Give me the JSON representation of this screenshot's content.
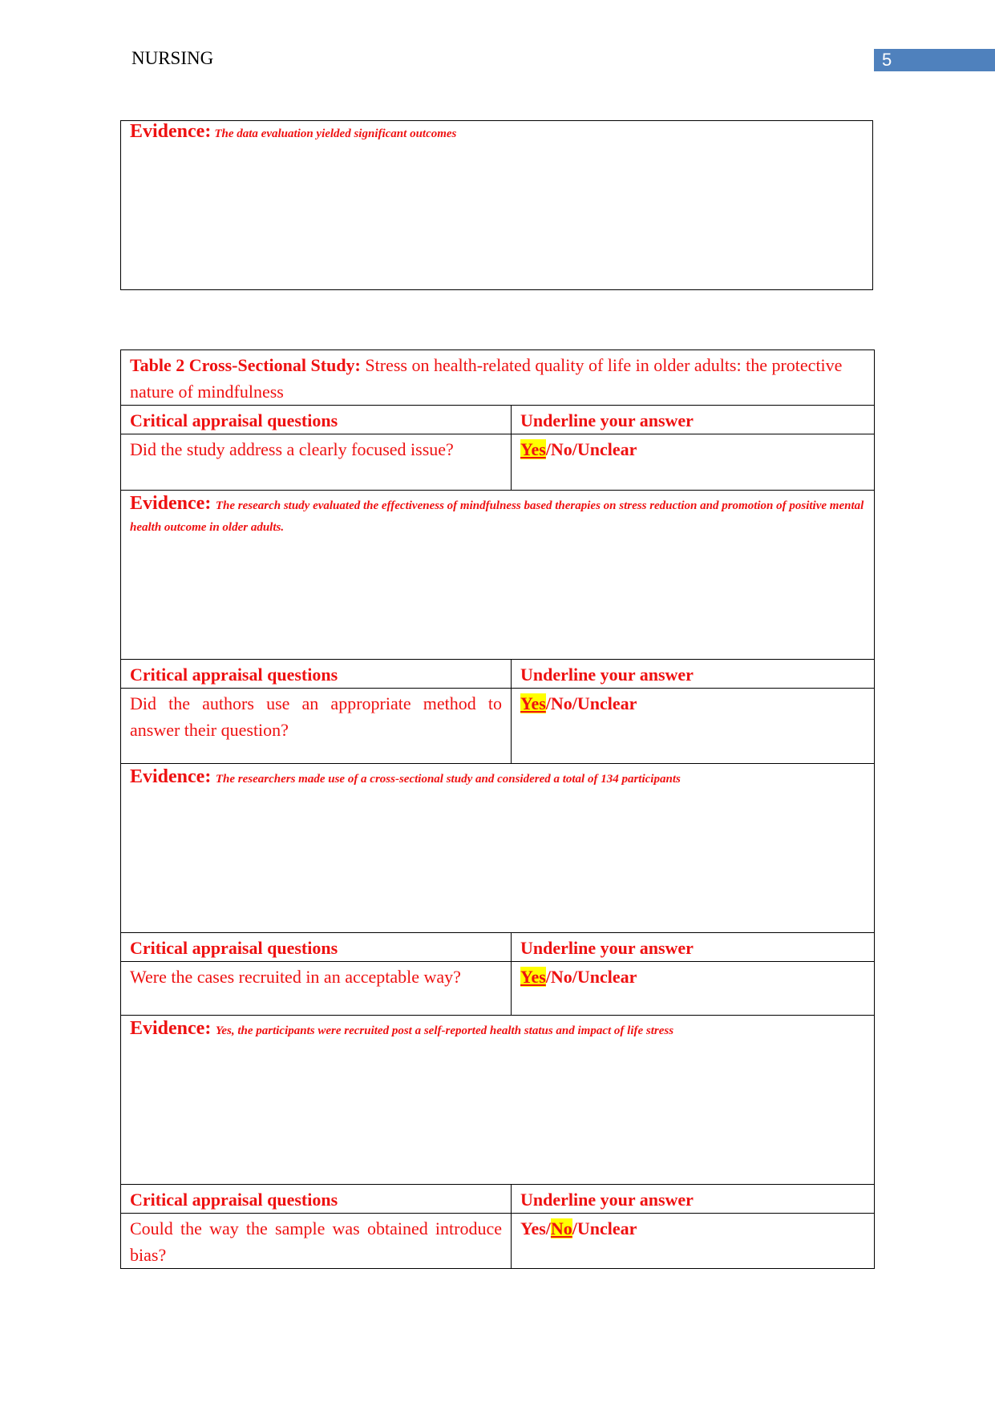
{
  "header": {
    "title": "NURSING",
    "page_number": "5"
  },
  "first_evidence": {
    "label": "Evidence:",
    "text": "The data evaluation yielded significant outcomes"
  },
  "table2": {
    "title_bold": "Table 2 Cross-Sectional Study:",
    "title_rest": " Stress on health-related quality of life in older adults: the protective nature of mindfulness",
    "col_question": "Critical appraisal questions",
    "col_answer": "Underline your answer",
    "rows": [
      {
        "question": "Did the study address a clearly focused issue?",
        "options": [
          "Yes",
          "No",
          "Unclear"
        ],
        "selected": "Yes",
        "evidence_label": "Evidence:",
        "evidence": "The research study evaluated the effectiveness of mindfulness based therapies on stress reduction and promotion of positive mental health outcome in older adults."
      },
      {
        "question": "Did the authors use an appropriate method to answer their question?",
        "options": [
          "Yes",
          "No",
          "Unclear"
        ],
        "selected": "Yes",
        "evidence_label": "Evidence:",
        "evidence": "The researchers made use of a cross-sectional study and considered a total of 134 participants"
      },
      {
        "question": "Were the cases recruited in an acceptable way?",
        "options": [
          "Yes",
          "No",
          "Unclear"
        ],
        "selected": "Yes",
        "evidence_label": "Evidence:",
        "evidence": "Yes, the participants were recruited post a self-reported health status and impact of life stress"
      },
      {
        "question": "Could the way the sample was obtained introduce bias?",
        "options": [
          "Yes",
          "No",
          "Unclear"
        ],
        "selected": "No"
      }
    ],
    "separator": "/",
    "highlight_color": "#ffff00",
    "text_color": "#ee1111"
  }
}
